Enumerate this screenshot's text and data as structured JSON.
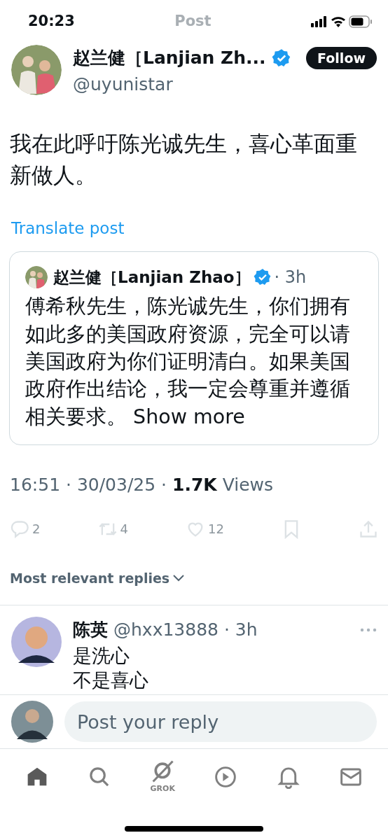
{
  "status_bar": {
    "time": "20:23"
  },
  "header": {
    "title": "Post"
  },
  "author": {
    "name": "赵兰健［Lanjian Zh...",
    "verified": true,
    "handle": "@uyunistar",
    "follow_label": "Follow"
  },
  "post": {
    "text": "我在此呼吁陈光诚先生，喜心革面重新做人。",
    "translate": "Translate post"
  },
  "quote": {
    "name": "赵兰健［Lanjian Zhao］",
    "verified": true,
    "time": "· 3h",
    "text": "傅希秋先生，陈光诚先生，你们拥有如此多的美国政府资源，完全可以请美国政府为你们证明清白。如果美国政府作出结论，我一定会尊重并遵循相关要求。",
    "more": "Show more"
  },
  "meta": {
    "time": "16:51 · 30/03/25 ·",
    "views_count": "1.7K",
    "views_label": "Views"
  },
  "actions": [
    {
      "kind": "reply",
      "count": "2"
    },
    {
      "kind": "repost",
      "count": "4"
    },
    {
      "kind": "like",
      "count": "12"
    },
    {
      "kind": "bookmark"
    },
    {
      "kind": "share"
    }
  ],
  "replies_sort": "Most relevant replies",
  "replies": [
    {
      "name": "陈英",
      "handle": "@hxx13888",
      "time": "· 3h",
      "lines": [
        "是洗心",
        "不是喜心"
      ]
    }
  ],
  "composer": {
    "placeholder": "Post your reply"
  },
  "tab_bar": [
    {
      "kind": "home",
      "selected": true
    },
    {
      "kind": "search",
      "selected": false
    },
    {
      "kind": "grok",
      "label": "GROK",
      "selected": false
    },
    {
      "kind": "video",
      "selected": false
    },
    {
      "kind": "notifications",
      "selected": false
    },
    {
      "kind": "messages",
      "selected": false
    }
  ]
}
